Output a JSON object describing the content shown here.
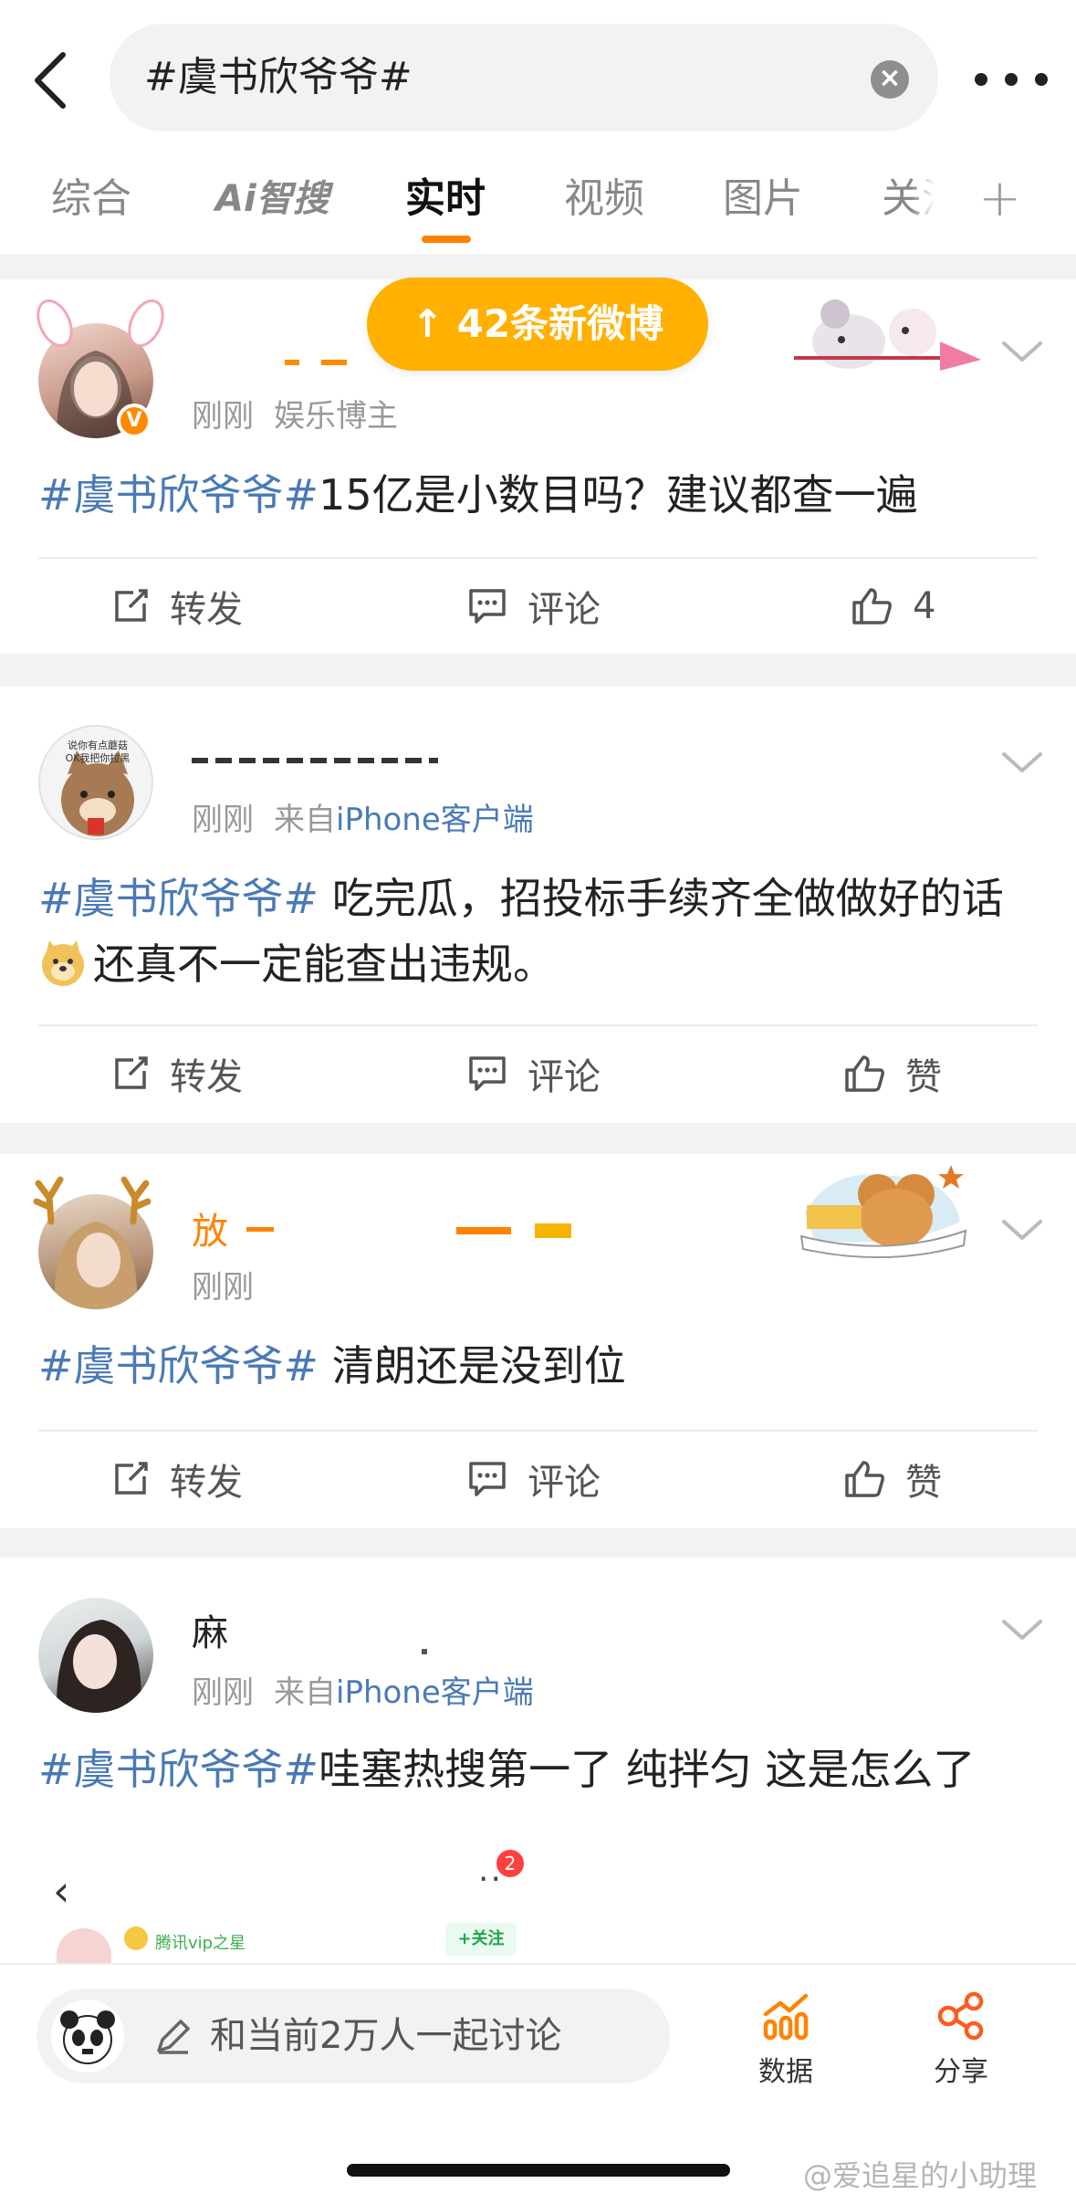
{
  "search": {
    "query": "#虞书欣爷爷#"
  },
  "tabs": [
    {
      "label": "综合"
    },
    {
      "label": "Ai智搜"
    },
    {
      "label": "实时"
    },
    {
      "label": "视频"
    },
    {
      "label": "图片"
    },
    {
      "label": "关注"
    }
  ],
  "active_tab": "实时",
  "new_posts_pill": "↑ 42条新微博",
  "posts": [
    {
      "time": "刚刚",
      "source": "娱乐博主",
      "hashtag": "#虞书欣爷爷#",
      "body": "15亿是小数目吗？建议都查一遍",
      "actions": {
        "repost": "转发",
        "comment": "评论",
        "like": "4"
      }
    },
    {
      "time": "刚刚",
      "source_prefix": "来自",
      "source": "iPhone客户端",
      "hashtag": "#虞书欣爷爷#",
      "body_line1": " 吃完瓜，招投标手续齐全做做好的话",
      "body_line2": "还真不一定能查出违规。",
      "actions": {
        "repost": "转发",
        "comment": "评论",
        "like": "赞"
      }
    },
    {
      "name_fragment": "放",
      "time": "刚刚",
      "hashtag": "#虞书欣爷爷#",
      "body": " 清朗还是没到位",
      "actions": {
        "repost": "转发",
        "comment": "评论",
        "like": "赞"
      }
    },
    {
      "name_fragment": "麻",
      "time": "刚刚",
      "source_prefix": "来自",
      "source": "iPhone客户端",
      "hashtag": "#虞书欣爷爷#",
      "body": "哇塞热搜第一了 纯拌匀 这是怎么了"
    }
  ],
  "embedded": {
    "back": "‹",
    "dots": "..",
    "badge": "2",
    "vip": "腾讯vip之星",
    "follow": "+关注"
  },
  "bottom": {
    "discuss_placeholder": "和当前2万人一起讨论",
    "data_label": "数据",
    "share_label": "分享"
  },
  "watermark": "@爱追星的小助理",
  "colors": {
    "accent": "#ff8200",
    "link": "#4a7ab5",
    "pill": "#ffb000"
  }
}
